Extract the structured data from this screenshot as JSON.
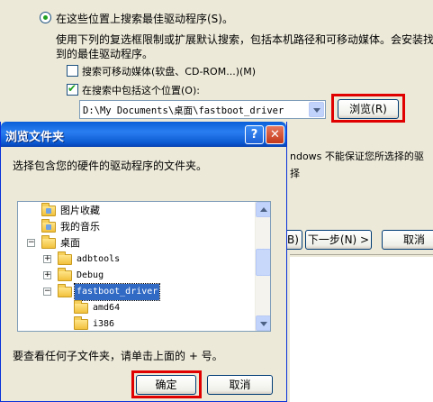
{
  "wizard": {
    "radio_search_label": "在这些位置上搜索最佳驱动程序(S)。",
    "desc_line1": "使用下列的复选框限制或扩展默认搜索，包括本机路径和可移动媒体。会安装找",
    "desc_line2": "到的最佳驱动程序。",
    "check_removable_label": "搜索可移动媒体(软盘、CD-ROM...)(M)",
    "check_removable": false,
    "check_include_label": "在搜索中包括这个位置(O):",
    "check_include": true,
    "path_value": "D:\\My Documents\\桌面\\fastboot_driver",
    "browse_label": "浏览(R)",
    "partial_text1": "ndows 不能保证您所选择的驱",
    "partial_text2": "择",
    "back_label": "B)",
    "next_label": "下一步(N) >",
    "cancel_label": "取消"
  },
  "dialog": {
    "title": "浏览文件夹",
    "help_glyph": "?",
    "close_glyph": "✕",
    "instruction": "选择包含您的硬件的驱动程序的文件夹。",
    "tree": [
      {
        "label": "图片收藏",
        "expander": "",
        "special": true,
        "mono": false,
        "selected": false
      },
      {
        "label": "我的音乐",
        "expander": "",
        "special": true,
        "mono": false,
        "selected": false
      },
      {
        "label": "桌面",
        "expander": "−",
        "special": false,
        "mono": false,
        "selected": false
      },
      {
        "label": "adbtools",
        "expander": "+",
        "special": false,
        "mono": true,
        "selected": false
      },
      {
        "label": "Debug",
        "expander": "+",
        "special": false,
        "mono": true,
        "selected": false
      },
      {
        "label": "fastboot_driver",
        "expander": "−",
        "special": false,
        "mono": true,
        "selected": true
      },
      {
        "label": "amd64",
        "expander": "",
        "special": false,
        "mono": true,
        "selected": false
      },
      {
        "label": "i386",
        "expander": "",
        "special": false,
        "mono": true,
        "selected": false
      }
    ],
    "hint": "要查看任何子文件夹，请单击上面的 + 号。",
    "ok_label": "确定",
    "cancel_label": "取消"
  },
  "colors": {
    "highlight_border": "#e00000",
    "selection": "#316ac5",
    "title_bar": "#0a5fd8"
  }
}
